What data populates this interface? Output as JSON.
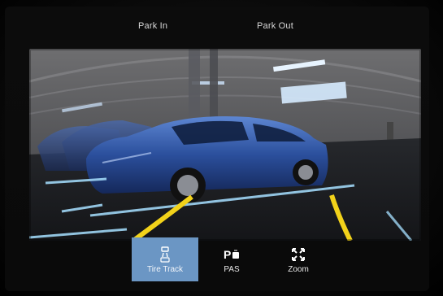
{
  "header": {
    "tabs": [
      {
        "label": "Park In"
      },
      {
        "label": "Park Out"
      }
    ]
  },
  "toolbar": {
    "items": [
      {
        "label": "Tire Track",
        "icon": "tire-track-icon",
        "active": true
      },
      {
        "label": "PAS",
        "icon": "pas-icon",
        "active": false
      },
      {
        "label": "Zoom",
        "icon": "zoom-icon",
        "active": false
      }
    ],
    "active_color": "#6b96c4"
  },
  "colors": {
    "guide_line": "#f2d21a",
    "car_body": "#2b4f9c",
    "parking_line": "#9fd6f5"
  }
}
